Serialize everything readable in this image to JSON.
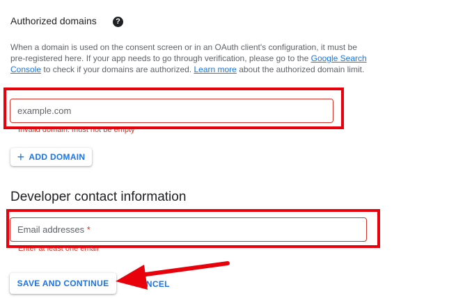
{
  "authorized_domains": {
    "title": "Authorized domains",
    "help_icon": "help-circle-icon",
    "description_part1": "When a domain is used on the consent screen or in an OAuth client's configuration, it must be pre-registered here. If your app needs to go through verification, please go to the ",
    "link_search_console": "Google Search Console",
    "description_part2": " to check if your domains are authorized. ",
    "link_learn_more": "Learn more",
    "description_part3": " about the authorized domain limit.",
    "domain_input": {
      "placeholder": "example.com",
      "value": ""
    },
    "domain_error": "Invalid domain: must not be empty",
    "add_domain_icon": "plus-icon",
    "add_domain_label": "ADD DOMAIN"
  },
  "developer_contact": {
    "title": "Developer contact information",
    "email_label": "Email addresses",
    "email_required_mark": "*",
    "email_value": "",
    "email_error": "Enter at least one email"
  },
  "actions": {
    "save_label": "SAVE AND CONTINUE",
    "cancel_label": "CANCEL"
  },
  "annotations": {
    "highlight_color": "#e8000b",
    "arrow_color": "#e8000b"
  }
}
